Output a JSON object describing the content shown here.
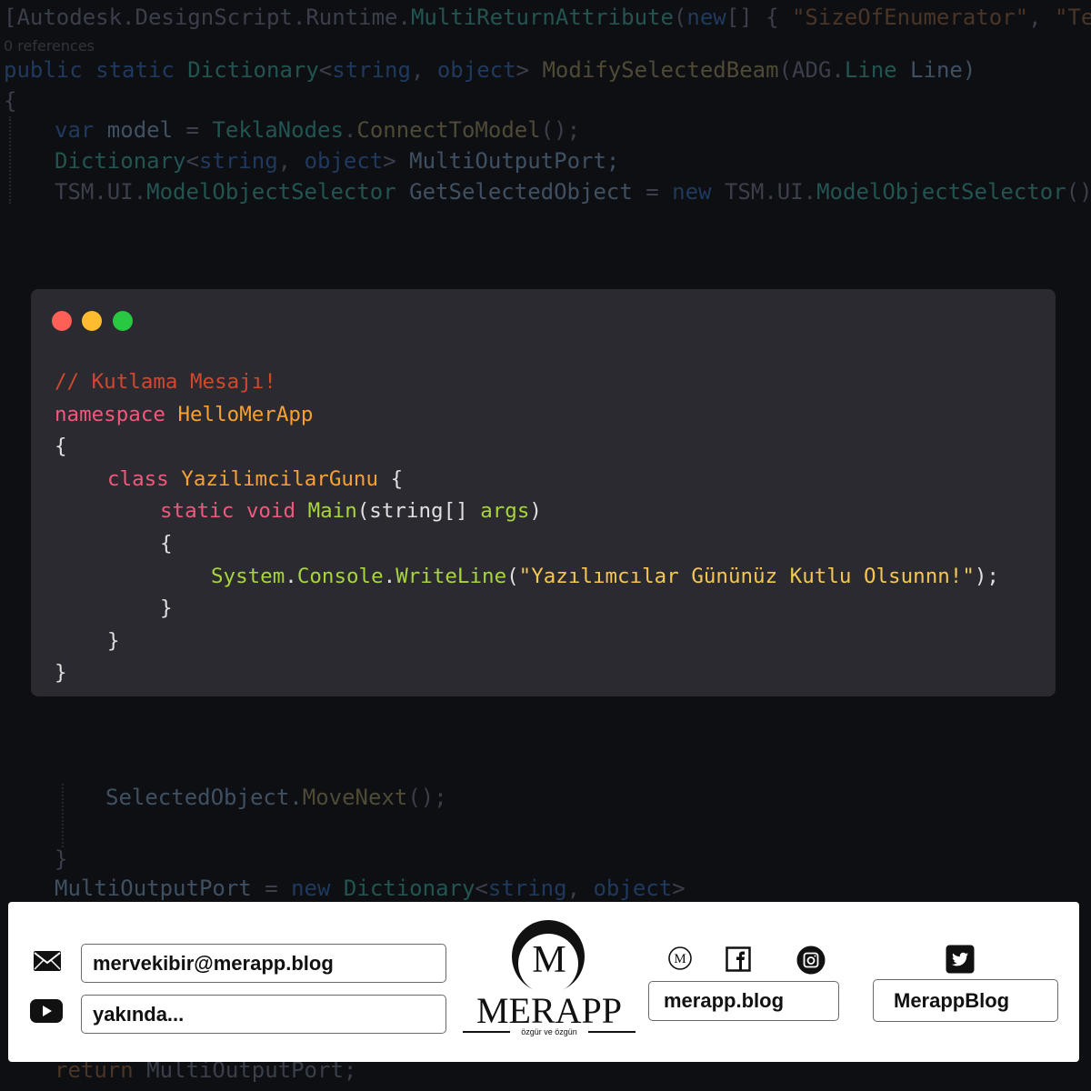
{
  "background_code": {
    "line1": {
      "a": "[Autodesk.DesignScript.Runtime.",
      "b": "MultiReturnAttribute",
      "c": "(",
      "d": "new",
      "e": "[] { ",
      "f": "\"SizeOfEnumerator\"",
      "g": ", ",
      "h": "\"Tekl"
    },
    "references": "0 references",
    "line3": {
      "a": "public",
      "b": " static ",
      "c": "Dictionary",
      "d": "<",
      "e": "string",
      "f": ", ",
      "g": "object",
      "h": "> ",
      "i": "ModifySelectedBeam",
      "j": "(ADG.",
      "k": "Line",
      "l": " Line)"
    },
    "line4": "{",
    "line5": {
      "a": "var",
      "b": " model ",
      "c": "= ",
      "d": "TeklaNodes",
      "e": ".",
      "f": "ConnectToModel",
      "g": "();"
    },
    "line6": {
      "a": "Dictionary",
      "b": "<",
      "c": "string",
      "d": ", ",
      "e": "object",
      "f": "> ",
      "g": "MultiOutputPort;"
    },
    "line7": {
      "a": "TSM.UI.",
      "b": "ModelObjectSelector",
      "c": " GetSelectedObject ",
      "d": "= ",
      "e": "new",
      "f": " TSM.UI.",
      "g": "ModelObjectSelector",
      "h": "();"
    },
    "line8": {
      "a": "SelectedObject.",
      "b": "MoveNext",
      "c": "();"
    },
    "line9": "}",
    "line10": {
      "a": "MultiOutputPort",
      "b": " = ",
      "c": "new",
      "d": " Dictionary",
      "e": "<",
      "f": "string",
      "g": ", ",
      "h": "object",
      "i": ">"
    },
    "line11": {
      "a": "return",
      "b": " MultiOutputPort;"
    }
  },
  "code_window": {
    "comment": "// Kutlama Mesajı!",
    "namespace_kw": "namespace",
    "namespace_name": "HelloMerApp",
    "open_brace_1": "{",
    "class_kw": "class",
    "class_name": "YazilimcilarGunu",
    "class_brace": " {",
    "static_kw": "static",
    "void_kw": "void",
    "main_name": "Main",
    "main_paren_open": "(",
    "string_type": "string",
    "array_brackets": "[] ",
    "args_name": "args",
    "main_paren_close": ")",
    "open_brace_3": "{",
    "system": "System",
    "dot1": ".",
    "console": "Console",
    "dot2": ".",
    "writeline": "WriteLine",
    "paren_open": "(",
    "message": "\"Yazılımcılar Gününüz Kutlu Olsunnn!\"",
    "paren_close": ");",
    "close_brace_3": "}",
    "close_brace_2": "}",
    "close_brace_1": "}"
  },
  "footer": {
    "email": "mervekibir@merapp.blog",
    "youtube": "yakında...",
    "logo_letter": "M",
    "logo_name": "MERAPP",
    "logo_tagline": "özgür ve özgün",
    "blog_icon_letter": "M",
    "website": "merapp.blog",
    "twitter": "MerappBlog"
  }
}
